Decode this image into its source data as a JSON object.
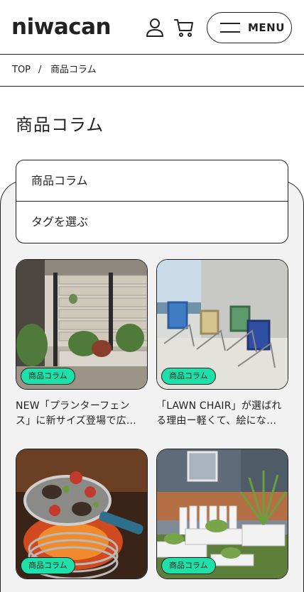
{
  "header": {
    "logo": "niwacan",
    "menu_label": "MENU",
    "user_icon": "user-icon",
    "cart_icon": "cart-icon",
    "menu_icon": "hamburger-icon"
  },
  "breadcrumb": {
    "home": "TOP",
    "separator": "/",
    "current": "商品コラム"
  },
  "page": {
    "title": "商品コラム"
  },
  "filters": {
    "category": "商品コラム",
    "tags": "タグを選ぶ"
  },
  "articles": [
    {
      "badge": "商品コラム",
      "title_line1": "NEW「プランターフェン",
      "title_line2": "ス」に新サイズ登場で広…"
    },
    {
      "badge": "商品コラム",
      "title_line1": "「LAWN CHAIR」が選ばれ",
      "title_line2": "る理由ー軽くて、絵にな…"
    },
    {
      "badge": "商品コラム",
      "title_line1": "",
      "title_line2": ""
    },
    {
      "badge": "商品コラム",
      "title_line1": "",
      "title_line2": ""
    }
  ],
  "colors": {
    "accent_badge": "#1de1a8",
    "border": "#222222",
    "panel_bg": "#f2f2f2"
  }
}
